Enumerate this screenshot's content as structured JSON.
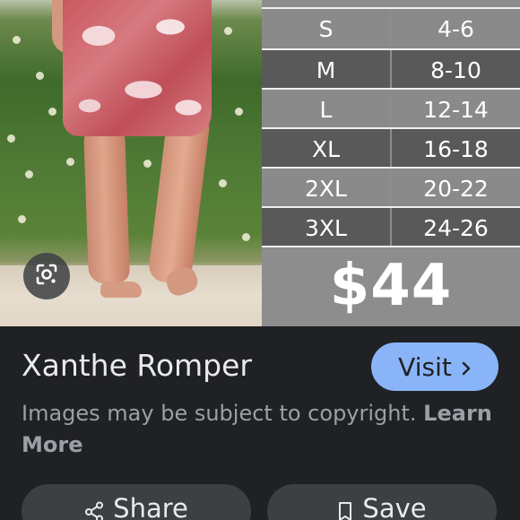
{
  "size_chart": {
    "rows": [
      {
        "size": "S",
        "range": "4-6"
      },
      {
        "size": "M",
        "range": "8-10"
      },
      {
        "size": "L",
        "range": "12-14"
      },
      {
        "size": "XL",
        "range": "16-18"
      },
      {
        "size": "2XL",
        "range": "20-22"
      },
      {
        "size": "3XL",
        "range": "24-26"
      }
    ],
    "price": "$44"
  },
  "product": {
    "title": "Xanthe Romper"
  },
  "actions": {
    "visit_label": "Visit",
    "share_label": "Share",
    "save_label": "Save"
  },
  "notice": {
    "text": "Images may be subject to copyright.",
    "link_label": "Learn More"
  },
  "icons": {
    "lens": "google-lens-icon",
    "visit": "chevron-right-icon",
    "share": "share-icon",
    "save": "bookmark-icon"
  },
  "colors": {
    "background": "#202124",
    "visit_button": "#8ab4f8",
    "action_button": "#3c4043",
    "chart_light": "#8a8a8a",
    "chart_dark": "#595959"
  }
}
